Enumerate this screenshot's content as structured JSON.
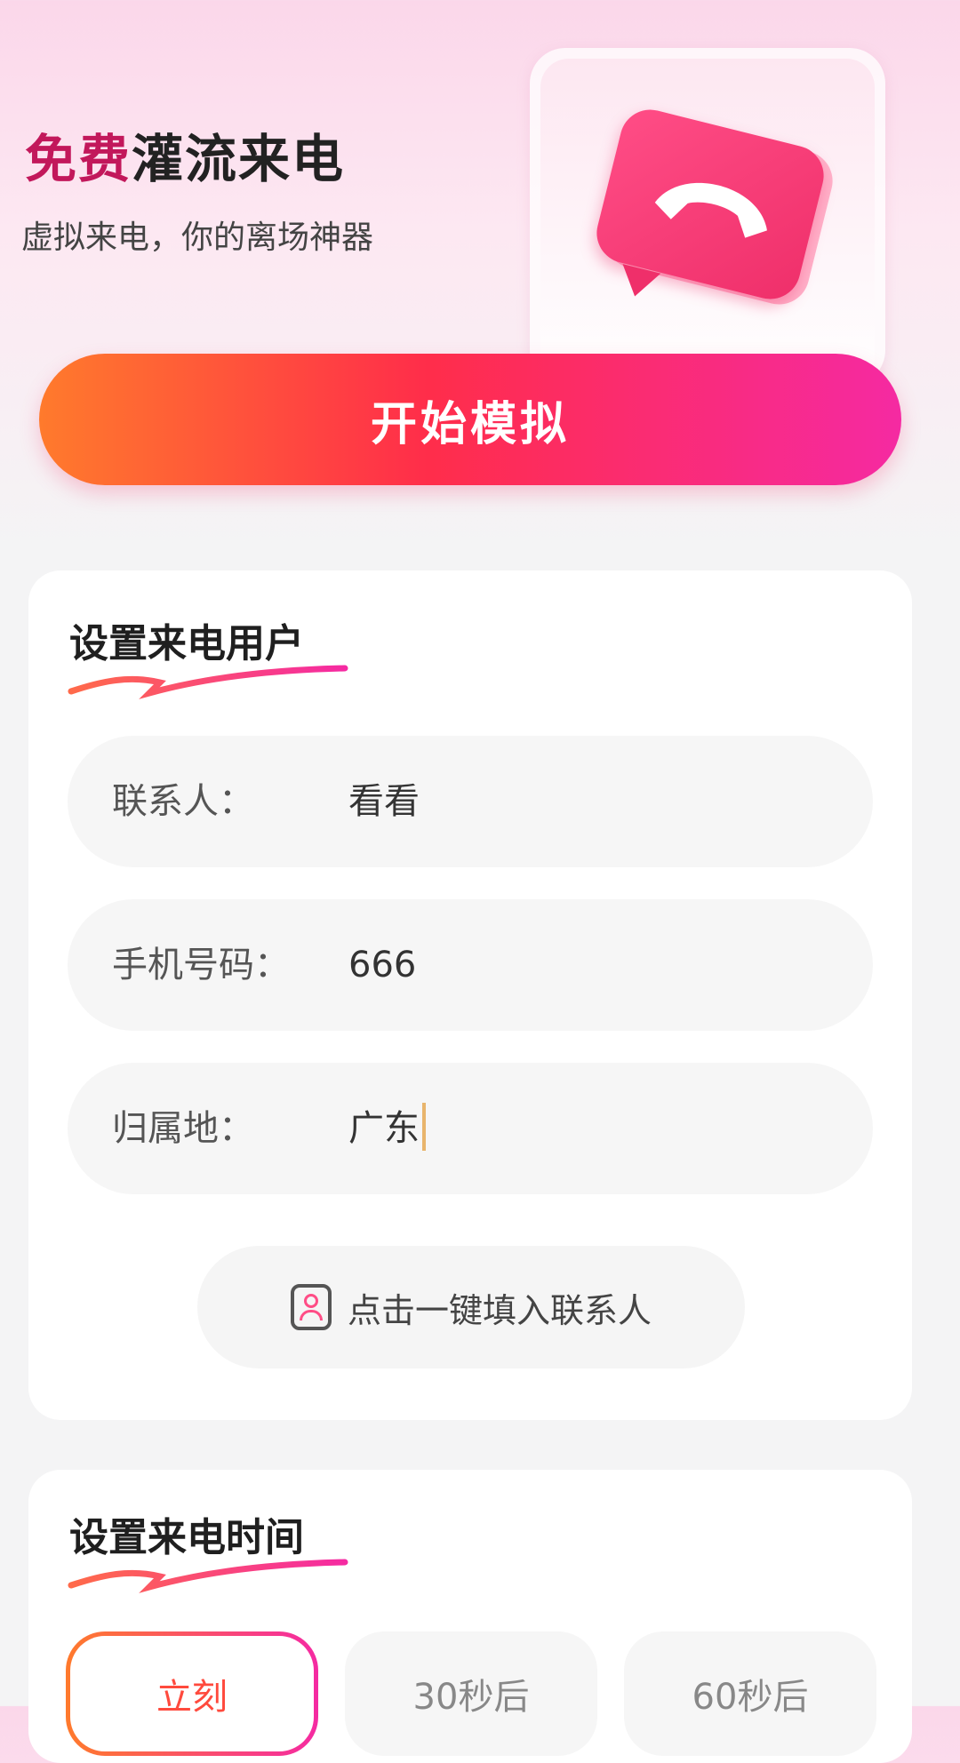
{
  "header": {
    "title_highlight": "免费",
    "title_rest": "灌流来电",
    "subtitle": "虚拟来电，你的离场神器"
  },
  "start_button": {
    "label": "开始模拟"
  },
  "caller_section": {
    "title": "设置来电用户",
    "fields": [
      {
        "label": "联系人：",
        "value": "看看"
      },
      {
        "label": "手机号码：",
        "value": "666"
      },
      {
        "label": "归属地：",
        "value": "广东"
      }
    ],
    "autofill_button": "点击一键填入联系人"
  },
  "time_section": {
    "title": "设置来电时间",
    "options": [
      "立刻",
      "30秒后",
      "60秒后"
    ],
    "selected": "立刻"
  },
  "colors": {
    "accent_start": "#ff7a2c",
    "accent_mid": "#ff2d4a",
    "accent_end": "#f52aa2",
    "icon_pink": "#ef2f6a"
  },
  "icons": [
    "phone-bubble-icon",
    "contact-icon"
  ]
}
